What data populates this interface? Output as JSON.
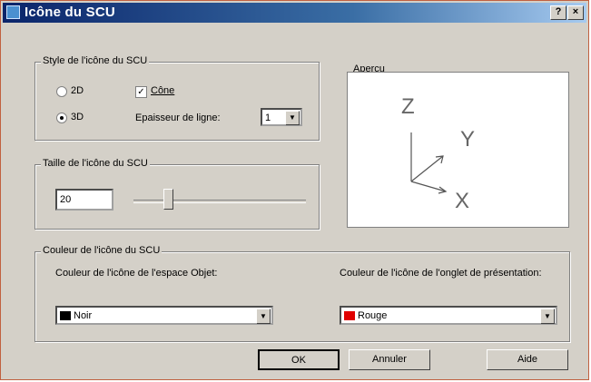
{
  "window": {
    "title": "Icône du SCU",
    "help_btn": "?",
    "close_btn": "×"
  },
  "style_group": {
    "legend": "Style de l'icône du SCU",
    "radio_2d": "2D",
    "radio_3d": "3D",
    "selected_radio": "3D",
    "cone_label": "Cône",
    "cone_checked": true,
    "line_width_label": "Epaisseur de ligne:",
    "line_width_value": "1"
  },
  "size_group": {
    "legend": "Taille de l'icône du SCU",
    "value": "20",
    "slider_level": 0.2
  },
  "preview": {
    "legend": "Aperçu",
    "axis_z": "Z",
    "axis_y": "Y",
    "axis_x": "X"
  },
  "color_group": {
    "legend": "Couleur de l'icône du SCU",
    "model_label": "Couleur de l'icône de l'espace Objet:",
    "model_value": "Noir",
    "model_color": "#000000",
    "layout_label": "Couleur de l'icône de l'onglet de présentation:",
    "layout_value": "Rouge",
    "layout_color": "#e00000"
  },
  "buttons": {
    "ok": "OK",
    "cancel": "Annuler",
    "help": "Aide"
  }
}
